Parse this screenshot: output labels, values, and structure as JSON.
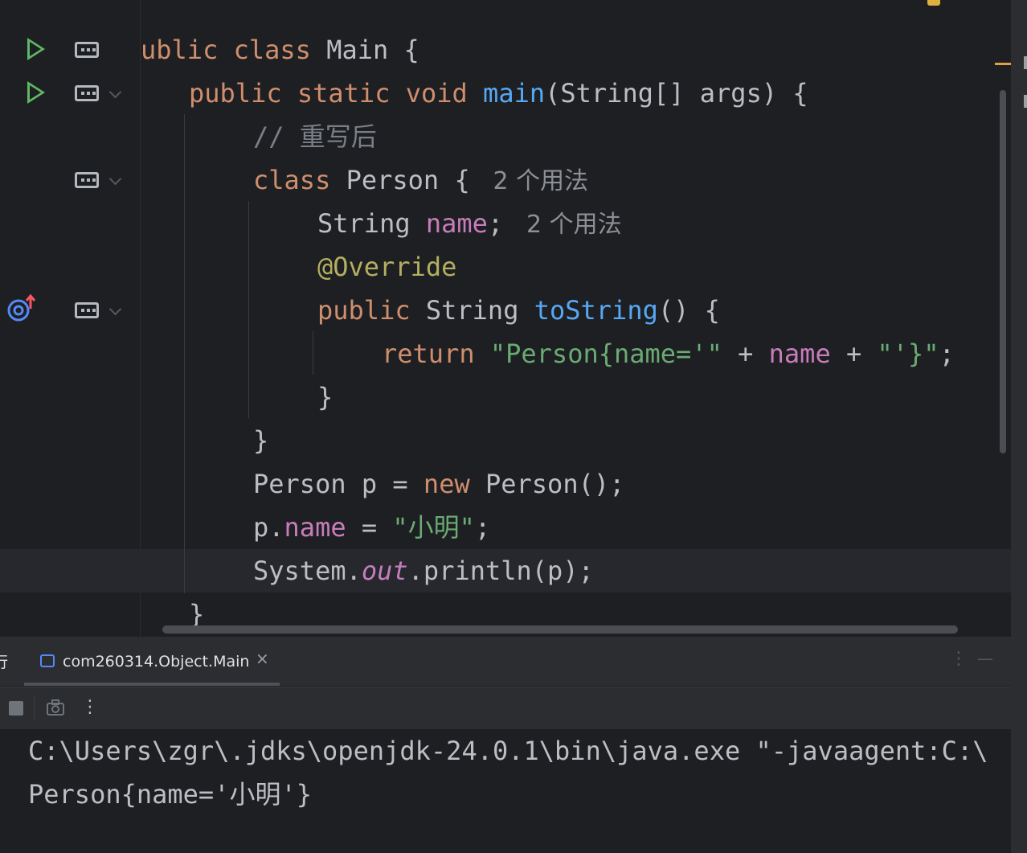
{
  "editor": {
    "lines": [
      {
        "segments": [
          {
            "t": "ublic ",
            "c": "kw"
          },
          {
            "t": "class ",
            "c": "kw"
          },
          {
            "t": "Main {",
            "c": ""
          }
        ]
      },
      {
        "segments": [
          {
            "t": "public ",
            "c": "kw"
          },
          {
            "t": "static ",
            "c": "kw"
          },
          {
            "t": "void ",
            "c": "kw"
          },
          {
            "t": "main",
            "c": "fn"
          },
          {
            "t": "(String[] args) {",
            "c": ""
          }
        ]
      },
      {
        "segments": [
          {
            "t": "// 重写后",
            "c": "cmt"
          }
        ]
      },
      {
        "segments": [
          {
            "t": "class ",
            "c": "kw"
          },
          {
            "t": "Person { ",
            "c": ""
          },
          {
            "t": " 2 个用法",
            "c": "hint"
          }
        ]
      },
      {
        "segments": [
          {
            "t": "String ",
            "c": ""
          },
          {
            "t": "name",
            "c": "fld"
          },
          {
            "t": "; ",
            "c": ""
          },
          {
            "t": " 2 个用法",
            "c": "hint"
          }
        ]
      },
      {
        "segments": [
          {
            "t": "@Override",
            "c": "ann"
          }
        ]
      },
      {
        "segments": [
          {
            "t": "public ",
            "c": "kw"
          },
          {
            "t": "String ",
            "c": ""
          },
          {
            "t": "toString",
            "c": "fn"
          },
          {
            "t": "() {",
            "c": ""
          }
        ]
      },
      {
        "segments": [
          {
            "t": "return ",
            "c": "kw"
          },
          {
            "t": "\"Person{name='\"",
            "c": "str"
          },
          {
            "t": " + ",
            "c": ""
          },
          {
            "t": "name",
            "c": "fld"
          },
          {
            "t": " + ",
            "c": ""
          },
          {
            "t": "\"'}\"",
            "c": "str"
          },
          {
            "t": ";",
            "c": ""
          }
        ]
      },
      {
        "segments": [
          {
            "t": "}",
            "c": ""
          }
        ]
      },
      {
        "segments": [
          {
            "t": "}",
            "c": ""
          }
        ]
      },
      {
        "segments": [
          {
            "t": "Person p = ",
            "c": ""
          },
          {
            "t": "new ",
            "c": "kw"
          },
          {
            "t": "Person();",
            "c": ""
          }
        ]
      },
      {
        "segments": [
          {
            "t": "p.",
            "c": ""
          },
          {
            "t": "name",
            "c": "fld"
          },
          {
            "t": " = ",
            "c": ""
          },
          {
            "t": "\"小明\"",
            "c": "str"
          },
          {
            "t": ";",
            "c": ""
          }
        ]
      },
      {
        "segments": [
          {
            "t": "System.",
            "c": ""
          },
          {
            "t": "out",
            "c": "stat"
          },
          {
            "t": ".println(p);",
            "c": ""
          }
        ]
      },
      {
        "segments": [
          {
            "t": "}",
            "c": ""
          }
        ]
      }
    ]
  },
  "run_panel": {
    "side_label": "行",
    "tab_label": "com260314.Object.Main",
    "close_glyph": "×",
    "more_glyph": "⋮",
    "minimize_glyph": "—",
    "toolbar_more_glyph": "⋮"
  },
  "console": {
    "lines": [
      "C:\\Users\\zgr\\.jdks\\openjdk-24.0.1\\bin\\java.exe \"-javaagent:C:\\",
      "Person{name='小明'}"
    ]
  },
  "colors": {
    "background": "#1e1f22",
    "keyword": "#cf8e6d",
    "function": "#56a8f5",
    "field": "#c77dbb",
    "string": "#6aab73",
    "annotation": "#b3ae60",
    "comment": "#7a7e85",
    "run_icon": "#5fb865"
  },
  "icons": [
    "run-icon",
    "structure-fold-icon",
    "chevron-down-icon",
    "override-method-icon",
    "stop-icon",
    "camera-icon",
    "terminal-tab-icon"
  ]
}
